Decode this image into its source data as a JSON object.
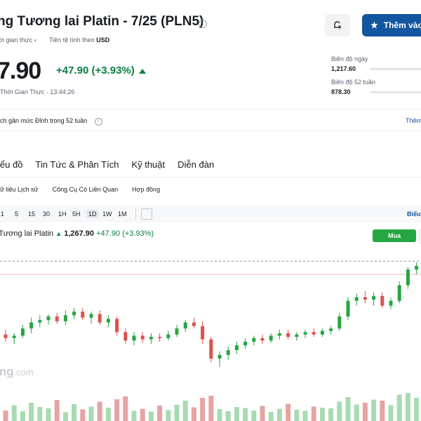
{
  "header": {
    "title": "ng Tương lai Platin - 7/25 (PLN5)",
    "sub_left": "ời gian thực",
    "sub_right_prefix": "Tiền tệ tính theo",
    "currency": "USD",
    "add_button": "Thêm vào"
  },
  "quote": {
    "price": "7.90",
    "change": "+47.90 (+3.93%)",
    "realtime_prefix": "Thời Gian Thực",
    "time": "13:44:26"
  },
  "ranges": [
    {
      "label": "Biên độ ngày",
      "low": "1,217.60"
    },
    {
      "label": "Biên độ 52 tuần",
      "low": "878.30"
    }
  ],
  "alert": {
    "text": "ch gần mức Đỉnh trong 52 tuần",
    "more": "Thêm"
  },
  "tabs": [
    "iểu đồ",
    "Tin Tức & Phân Tích",
    "Kỹ thuật",
    "Diễn đàn"
  ],
  "subtabs": [
    "ữ liệu Lịch sử",
    "Công Cụ Có Liên Quan",
    "Hợp đồng"
  ],
  "timeframes": [
    "1",
    "5",
    "15",
    "30",
    "1H",
    "5H",
    "1D",
    "1W",
    "1M"
  ],
  "selected_timeframe": "1D",
  "chart_more": "Biểu",
  "legend": {
    "name": "Tương lai Platin",
    "last": "1,267.90",
    "change": "+47.90",
    "pct": "(+3.93%)"
  },
  "buy_label": "Mua",
  "watermark": {
    "brand": "ing",
    "suffix": ".com"
  },
  "colors": {
    "up": "#26a641",
    "down": "#d9534f",
    "accent": "#1256a0"
  },
  "chart_data": {
    "type": "candlestick",
    "candles": [
      [
        1214,
        1218,
        1208,
        1211
      ],
      [
        1211,
        1215,
        1206,
        1213
      ],
      [
        1213,
        1222,
        1211,
        1219
      ],
      [
        1219,
        1228,
        1215,
        1224
      ],
      [
        1224,
        1230,
        1220,
        1226
      ],
      [
        1226,
        1231,
        1222,
        1229
      ],
      [
        1229,
        1232,
        1223,
        1225
      ],
      [
        1225,
        1234,
        1222,
        1230
      ],
      [
        1230,
        1236,
        1227,
        1233
      ],
      [
        1233,
        1236,
        1226,
        1228
      ],
      [
        1228,
        1233,
        1223,
        1231
      ],
      [
        1231,
        1234,
        1222,
        1224
      ],
      [
        1224,
        1230,
        1220,
        1227
      ],
      [
        1227,
        1229,
        1213,
        1216
      ],
      [
        1216,
        1219,
        1206,
        1209
      ],
      [
        1209,
        1216,
        1205,
        1213
      ],
      [
        1213,
        1216,
        1207,
        1210
      ],
      [
        1210,
        1215,
        1206,
        1212
      ],
      [
        1212,
        1215,
        1208,
        1211
      ],
      [
        1211,
        1217,
        1209,
        1214
      ],
      [
        1214,
        1222,
        1212,
        1219
      ],
      [
        1219,
        1226,
        1216,
        1224
      ],
      [
        1224,
        1228,
        1219,
        1221
      ],
      [
        1221,
        1225,
        1206,
        1210
      ],
      [
        1210,
        1212,
        1191,
        1194
      ],
      [
        1194,
        1200,
        1187,
        1197
      ],
      [
        1197,
        1204,
        1193,
        1201
      ],
      [
        1201,
        1208,
        1198,
        1205
      ],
      [
        1205,
        1211,
        1202,
        1208
      ],
      [
        1208,
        1213,
        1205,
        1211
      ],
      [
        1211,
        1214,
        1206,
        1209
      ],
      [
        1209,
        1215,
        1207,
        1213
      ],
      [
        1213,
        1218,
        1210,
        1215
      ],
      [
        1215,
        1218,
        1210,
        1212
      ],
      [
        1212,
        1216,
        1209,
        1214
      ],
      [
        1214,
        1218,
        1211,
        1216
      ],
      [
        1216,
        1219,
        1212,
        1214
      ],
      [
        1214,
        1219,
        1212,
        1217
      ],
      [
        1217,
        1221,
        1214,
        1219
      ],
      [
        1219,
        1232,
        1217,
        1229
      ],
      [
        1229,
        1245,
        1226,
        1242
      ],
      [
        1242,
        1248,
        1238,
        1245
      ],
      [
        1245,
        1250,
        1240,
        1243
      ],
      [
        1243,
        1249,
        1238,
        1246
      ],
      [
        1246,
        1249,
        1236,
        1238
      ],
      [
        1238,
        1245,
        1235,
        1242
      ],
      [
        1242,
        1258,
        1240,
        1255
      ],
      [
        1255,
        1270,
        1252,
        1268
      ],
      [
        1268,
        1274,
        1264,
        1271
      ]
    ],
    "volumes": [
      30,
      45,
      28,
      52,
      40,
      36,
      60,
      25,
      48,
      33,
      41,
      55,
      38,
      62,
      70,
      29,
      35,
      27,
      44,
      31,
      46,
      58,
      39,
      66,
      72,
      34,
      28,
      40,
      37,
      30,
      43,
      26,
      35,
      49,
      32,
      29,
      41,
      38,
      36,
      55,
      68,
      47,
      52,
      61,
      58,
      45,
      75,
      80,
      66
    ],
    "reference_price": 1275,
    "previous_close": 1264
  }
}
